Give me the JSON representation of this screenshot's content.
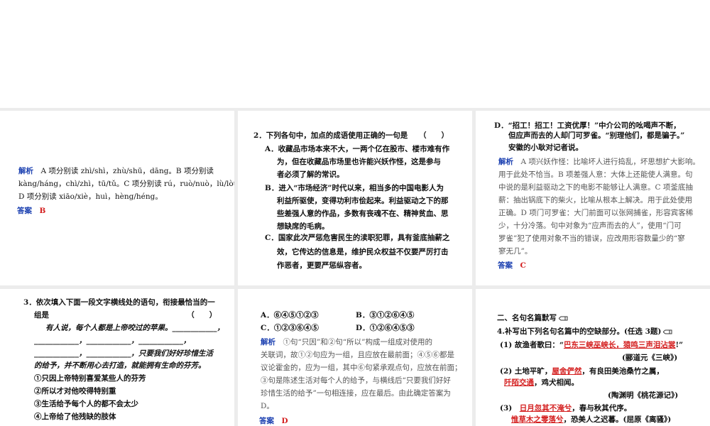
{
  "p1": {
    "analysis_label": "解析",
    "analysis_lines": [
      "A 项分别读 zhì/shì，zhù/shū，dāng。B 项分别读",
      "kàng/háng，chì/zhì，tū/tǔ。C 项分别读 rú，ruò/nuò，lù/lòu。",
      "D 项分别读 xiāo/xiè，huì，hèng/héng。"
    ],
    "answer_label": "答案",
    "answer_value": "B"
  },
  "p2": {
    "question": "2．下列各句中，加点的成语使用正确的一句是　　（　　）",
    "options": [
      [
        "A．收藏品市场本来不大，一两个亿在股市、楼市难有作",
        "为，但在收藏品市场里也许能兴妖作怪，这是参与",
        "者必须了解的常识。"
      ],
      [
        "B．进入“市场经济”时代以来，相当多的中国电影人为",
        "利益所驱使，变得功利市侩起来。利益驱动之下的那",
        "些差强人意的作品，多数有丧魂不在、精神贫血、思",
        "想缺席的毛病。"
      ],
      [
        "C．国家此次严惩危害民生的渎职犯罪，具有釜底抽薪之",
        "效，它传达的信息是，维护民众权益不仅要严厉打击",
        "作恶者，更要严惩纵容者。"
      ]
    ]
  },
  "p3": {
    "option_d": [
      "D．“招工！招工！工资优厚！”中介公司的吆喝声不断，",
      "但应声而去的人却门可罗雀。“别理他们，都是骗子。”",
      "安徽的小耿对记者说。"
    ],
    "analysis_label": "解析",
    "analysis_first": "A 项兴妖作怪：比喻坏人进行捣乱，坏思想扩大影响。",
    "analysis_lines": [
      "用于此处不恰当。B 项差强人意：大体上还能使人满意。句",
      "中说的是利益驱动之下的电影不能够让人满意。C 项釜底抽",
      "薪：抽出锅底下的柴火，比喻从根本上解决。用于此处使用",
      "正确。D 项门可罗雀：大门前面可以张网捕雀，形容宾客稀",
      "少，十分冷落。句中对象为“应声而去的人”，使用“门可",
      "罗雀”犯了使用对象不当的错误，应改用形容数量少的“寥",
      "寥无几”。"
    ],
    "answer_label": "答案",
    "answer_value": "C"
  },
  "p4": {
    "question_lines": [
      "3．依次填入下面一段文字横线处的语句，衔接最恰当的一",
      "组是　　　　　　　　　　　　　　　　　　　（　　）"
    ],
    "passage_lines": [
      "有人说，每个人都是上帝咬过的苹果。____________，",
      "____________，____________，____________，",
      "____________，____________，只要我们好好珍惜生活",
      "的给予，并不断用心去打造，就能拥有生命的芬芳。"
    ],
    "items": [
      "①只因上帝特别喜爱某些人的芬芳",
      "②所以才对他咬得特别重",
      "③生活给予每个人的都不会太少",
      "④上帝给了他残缺的肢体"
    ]
  },
  "p5": {
    "options_row1": [
      "A．⑥④⑤①②③",
      "B．③①②⑥④⑤"
    ],
    "options_row2": [
      "C．①②③⑥④⑤",
      "D．①②⑥④⑤③"
    ],
    "analysis_label": "解析",
    "analysis_first": "①句“只因”和②句“所以”构成一组成对使用的",
    "analysis_lines": [
      "关联词，故①②句应为一组，且应放在最前面；④⑤⑥都是",
      "议论霍金的，应为一组，其中⑥句紧承观点句，应放在前面；",
      "③句是陈述生活对每个人的给予，与横线后“只要我们好好",
      "珍惜生活的给予”一句相连接，应在最后。由此确定答案为",
      "D。"
    ],
    "answer_label": "答案",
    "answer_value": "D"
  },
  "p6": {
    "heading": "二、名句名篇默写",
    "instruction": "4.补写出下列名句名篇中的空缺部分。(任选 3题)",
    "l1_pre": "(1) 故渔者歌曰：“",
    "l1_ans": "巴东三峡巫峡长，猿鸣三声泪沾裳",
    "l1_post": "!”",
    "l1_src": "(郦道元《三峡》)",
    "l2_pre": "(2) 土地平旷，",
    "l2_ans": "屋舍俨然",
    "l2_post": "，有良田美池桑竹之属，",
    "l3_ans": "阡陌交通",
    "l3_post": "，鸡犬相闻。",
    "l3_src": "(陶渊明《桃花源记》)",
    "l4_pre": "(3)",
    "l4_ans": "日月忽其不淹兮",
    "l4_post": "，春与秋其代序。",
    "l5_ans": "惟草木之零落兮",
    "l5_post": "，恐美人之迟暮。(屈原《离骚》)"
  }
}
